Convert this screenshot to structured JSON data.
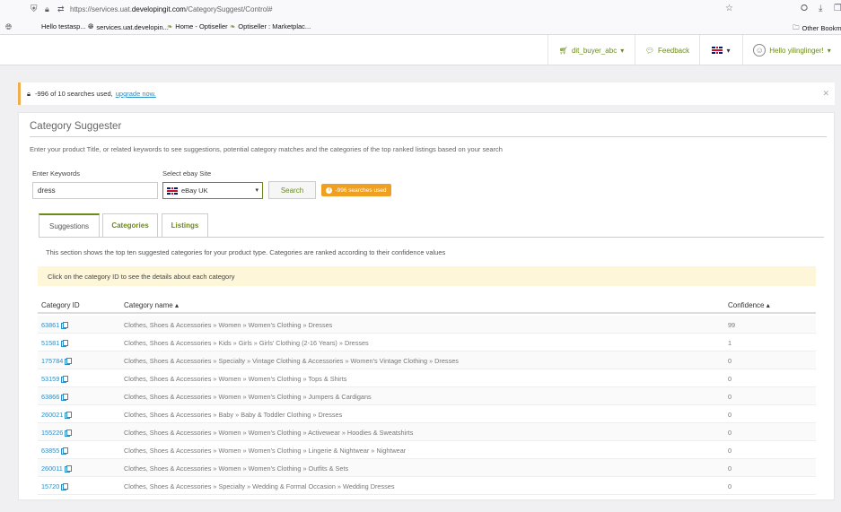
{
  "browser": {
    "url_prefix": "https://services.uat.",
    "url_domain": "developingit.com",
    "url_path": "/CategorySuggest/Control#",
    "bookmarks": [
      "Hello testasp...",
      "services.uat.developin...",
      "Home - Optiseller",
      "Optiseller : Marketplac...",
      "Other Bookmarks"
    ]
  },
  "header": {
    "account": "dit_buyer_abc",
    "feedback": "Feedback",
    "greeting": "Hello yilinglinger!"
  },
  "alert": {
    "text": "-996 of 10 searches used,",
    "link": "upgrade now."
  },
  "panel": {
    "title": "Category Suggester",
    "description": "Enter your product Title, or related keywords to see suggestions, potential category matches and the categories of the top ranked listings based on your search"
  },
  "form": {
    "keywords_label": "Enter Keywords",
    "keywords_value": "dress",
    "site_label": "Select ebay Site",
    "site_value": "eBay UK",
    "search_button": "Search",
    "used_badge": "-996 searches used"
  },
  "tabs": [
    "Suggestions",
    "Categories",
    "Listings"
  ],
  "section": {
    "description": "This section shows the top ten suggested categories for your product type. Categories are ranked according to their confidence values",
    "info": "Click on the category ID to see the details about each category"
  },
  "table": {
    "headers": {
      "id": "Category ID",
      "name": "Category name",
      "confidence": "Confidence"
    },
    "rows": [
      {
        "id": "63861",
        "name": "Clothes, Shoes & Accessories » Women » Women's Clothing » Dresses",
        "confidence": "99"
      },
      {
        "id": "51581",
        "name": "Clothes, Shoes & Accessories » Kids » Girls » Girls' Clothing (2-16 Years) » Dresses",
        "confidence": "1"
      },
      {
        "id": "175784",
        "name": "Clothes, Shoes & Accessories » Specialty » Vintage Clothing & Accessories » Women's Vintage Clothing » Dresses",
        "confidence": "0"
      },
      {
        "id": "53159",
        "name": "Clothes, Shoes & Accessories » Women » Women's Clothing » Tops & Shirts",
        "confidence": "0"
      },
      {
        "id": "63866",
        "name": "Clothes, Shoes & Accessories » Women » Women's Clothing » Jumpers & Cardigans",
        "confidence": "0"
      },
      {
        "id": "260021",
        "name": "Clothes, Shoes & Accessories » Baby » Baby & Toddler Clothing » Dresses",
        "confidence": "0"
      },
      {
        "id": "155226",
        "name": "Clothes, Shoes & Accessories » Women » Women's Clothing » Activewear » Hoodies & Sweatshirts",
        "confidence": "0"
      },
      {
        "id": "63855",
        "name": "Clothes, Shoes & Accessories » Women » Women's Clothing » Lingerie & Nightwear » Nightwear",
        "confidence": "0"
      },
      {
        "id": "260011",
        "name": "Clothes, Shoes & Accessories » Women » Women's Clothing » Outfits & Sets",
        "confidence": "0"
      },
      {
        "id": "15720",
        "name": "Clothes, Shoes & Accessories » Specialty » Wedding & Formal Occasion » Wedding Dresses",
        "confidence": "0"
      }
    ]
  }
}
